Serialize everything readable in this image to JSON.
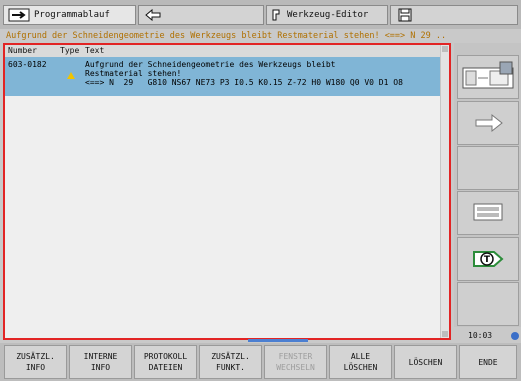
{
  "tabs": [
    {
      "label": "Programmablauf",
      "active": true,
      "icon": "program-run-icon"
    },
    {
      "label": "",
      "active": false,
      "icon": "manual-mode-icon"
    },
    {
      "label": "Werkzeug-Editor",
      "active": false,
      "icon": "tool-editor-icon"
    },
    {
      "label": "",
      "active": false,
      "icon": "disk-icon"
    }
  ],
  "status_message": "Aufgrund der Schneidengeometrie des Werkzeugs bleibt Restmaterial stehen! <==> N  29  ..",
  "message_list": {
    "columns": {
      "number": "Number",
      "type": "Type",
      "text": "Text"
    },
    "rows": [
      {
        "number": "603-0182",
        "type": "warning",
        "line1": "Aufgrund der Schneidengeometrie des Werkzeugs bleibt",
        "line2": "Restmaterial stehen!",
        "line3": "<==> N  29   G810 NS67 NE73 P3 I0.5 K0.15 Z-72 H0 W180 Q0 V0 D1 O8"
      }
    ]
  },
  "right_softkeys": [
    {
      "icon": "program-structure-icon"
    },
    {
      "icon": "arrow-right-icon"
    },
    {
      "icon": ""
    },
    {
      "icon": "machine-table-icon"
    },
    {
      "icon": "tool-t-icon"
    },
    {
      "icon": ""
    }
  ],
  "clock": "10:03",
  "softkeys": [
    {
      "line1": "ZUSÄTZL.",
      "line2": "INFO",
      "disabled": false
    },
    {
      "line1": "INTERNE",
      "line2": "INFO",
      "disabled": false
    },
    {
      "line1": "PROTOKOLL",
      "line2": "DATEIEN",
      "disabled": false
    },
    {
      "line1": "ZUSÄTZL.",
      "line2": "FUNKT.",
      "disabled": false
    },
    {
      "line1": "FENSTER",
      "line2": "WECHSELN",
      "disabled": true
    },
    {
      "line1": "ALLE",
      "line2": "LÖSCHEN",
      "disabled": false
    },
    {
      "line1": "LÖSCHEN",
      "line2": "",
      "disabled": false
    },
    {
      "line1": "ENDE",
      "line2": "",
      "disabled": false
    }
  ],
  "colors": {
    "warning": "#f0c400",
    "selected_row": "#80b5d6",
    "panel_border": "#e22424",
    "status_text": "#b07000"
  }
}
